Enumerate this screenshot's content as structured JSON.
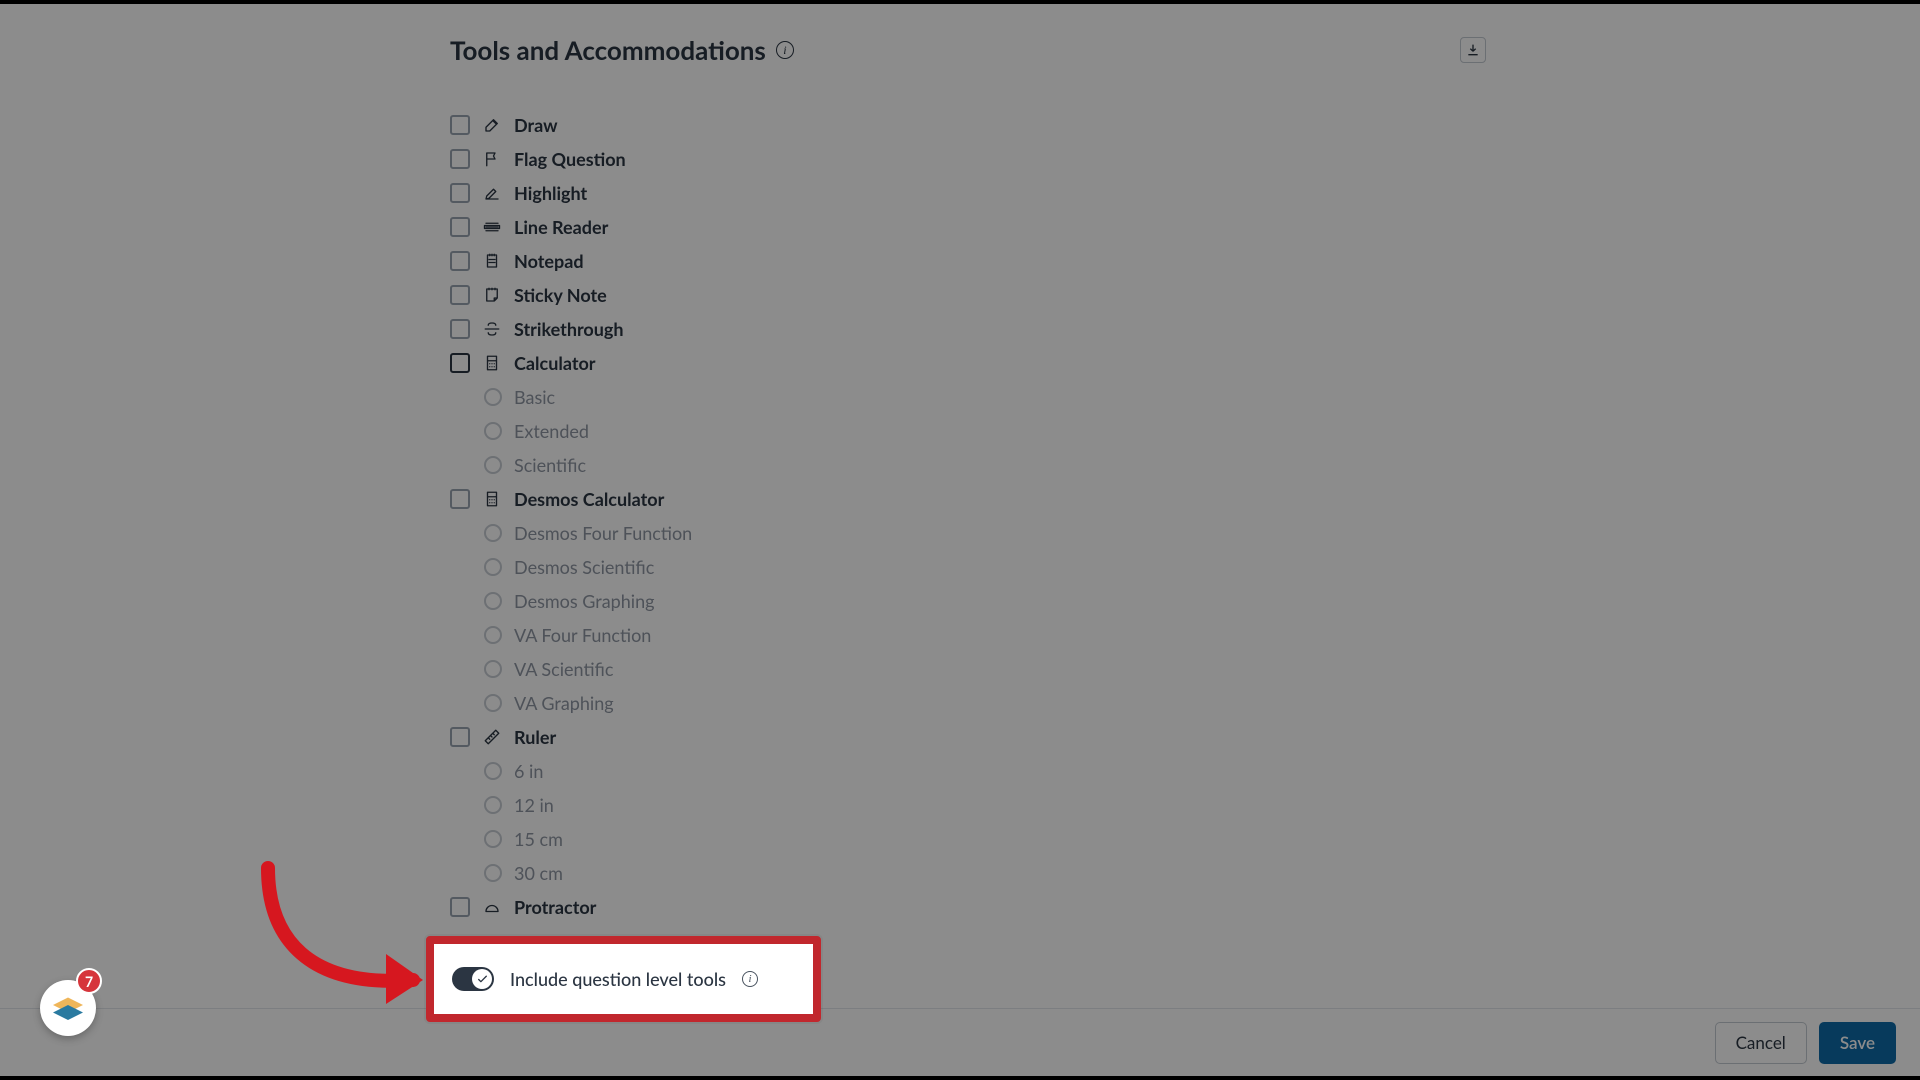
{
  "section": {
    "title": "Tools and Accommodations"
  },
  "tools": {
    "draw": "Draw",
    "flag_question": "Flag Question",
    "highlight": "Highlight",
    "line_reader": "Line Reader",
    "notepad": "Notepad",
    "sticky_note": "Sticky Note",
    "strikethrough": "Strikethrough",
    "calculator": {
      "label": "Calculator",
      "options": {
        "basic": "Basic",
        "extended": "Extended",
        "scientific": "Scientific"
      }
    },
    "desmos": {
      "label": "Desmos Calculator",
      "options": {
        "four_function": "Desmos Four Function",
        "scientific": "Desmos Scientific",
        "graphing": "Desmos Graphing",
        "va_four_function": "VA Four Function",
        "va_scientific": "VA Scientific",
        "va_graphing": "VA Graphing"
      }
    },
    "ruler": {
      "label": "Ruler",
      "options": {
        "six_in": "6 in",
        "twelve_in": "12 in",
        "fifteen_cm": "15 cm",
        "thirty_cm": "30 cm"
      }
    },
    "protractor": "Protractor"
  },
  "question_level_tools": {
    "label": "Include question level tools",
    "enabled": true
  },
  "footer": {
    "cancel": "Cancel",
    "save": "Save"
  },
  "badge": {
    "count": "7"
  }
}
